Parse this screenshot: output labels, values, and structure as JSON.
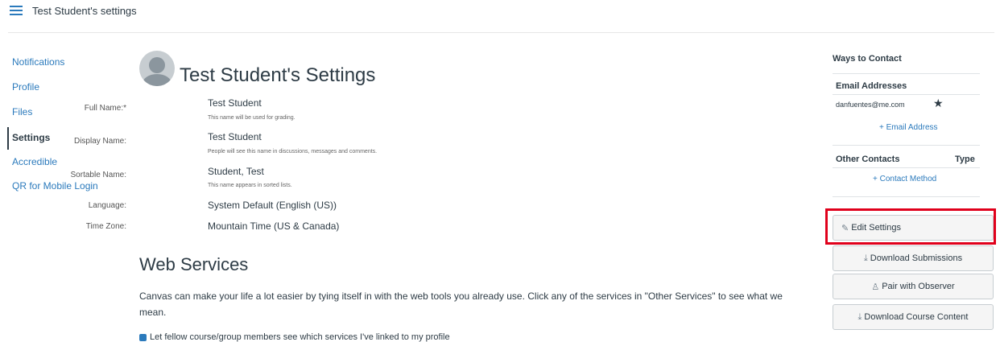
{
  "header": {
    "breadcrumb": "Test Student's settings"
  },
  "nav": {
    "items": [
      {
        "label": "Notifications",
        "active": false
      },
      {
        "label": "Profile",
        "active": false
      },
      {
        "label": "Files",
        "active": false
      },
      {
        "label": "Settings",
        "active": true
      },
      {
        "label": "Accredible",
        "active": false
      },
      {
        "label": "QR for Mobile Login",
        "active": false
      }
    ]
  },
  "main": {
    "title": "Test Student's Settings",
    "fields": [
      {
        "label": "Full Name:*",
        "value": "Test Student",
        "hint": "This name will be used for grading."
      },
      {
        "label": "Display Name:",
        "value": "Test Student",
        "hint": "People will see this name in discussions, messages and comments."
      },
      {
        "label": "Sortable Name:",
        "value": "Student, Test",
        "hint": "This name appears in sorted lists."
      },
      {
        "label": "Language:",
        "value": "System Default (English (US))",
        "hint": ""
      },
      {
        "label": "Time Zone:",
        "value": "Mountain Time (US & Canada)",
        "hint": ""
      }
    ],
    "web_services": {
      "title": "Web Services",
      "description": "Canvas can make your life a lot easier by tying itself in with the web tools you already use. Click any of the services in \"Other Services\" to see what we mean.",
      "checkbox_label": "Let fellow course/group members see which services I've linked to my profile",
      "checkbox_checked": true
    }
  },
  "contact": {
    "heading": "Ways to Contact",
    "email_heading": "Email Addresses",
    "email": "danfuentes@me.com",
    "add_email": "Email Address",
    "other_heading": "Other Contacts",
    "type_heading": "Type",
    "add_contact": "Contact Method"
  },
  "actions": {
    "edit_settings": "Edit Settings",
    "download_submissions": "Download Submissions",
    "pair_observer": "Pair with Observer",
    "download_course": "Download Course Content"
  },
  "colors": {
    "link": "#2b7abc",
    "text": "#2d3b45",
    "highlight": "#e0001b"
  }
}
